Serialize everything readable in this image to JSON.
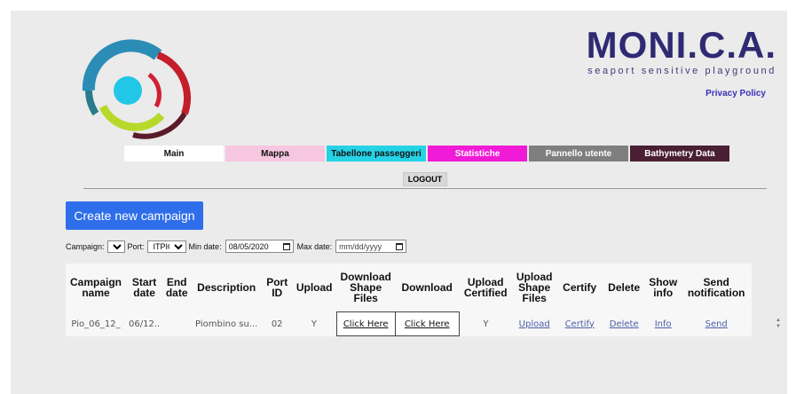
{
  "brand": {
    "title": "MONI.C.A.",
    "subtitle": "seaport sensitive playground",
    "privacy": "Privacy Policy"
  },
  "nav": [
    {
      "label": "Main",
      "bg": "#ffffff",
      "fg": "#111111"
    },
    {
      "label": "Mappa",
      "bg": "#f7c6e0",
      "fg": "#111111"
    },
    {
      "label": "Tabellone passeggeri",
      "bg": "#26d3e6",
      "fg": "#111111"
    },
    {
      "label": "Statistiche",
      "bg": "#f01bd6",
      "fg": "#ffffff"
    },
    {
      "label": "Pannello utente",
      "bg": "#7f7f7f",
      "fg": "#ffffff"
    },
    {
      "label": "Bathymetry Data",
      "bg": "#4a1f33",
      "fg": "#ffffff"
    }
  ],
  "logout": "LOGOUT",
  "create_button": "Create new campaign",
  "filters": {
    "campaign_label": "Campaign:",
    "port_label": "Port:",
    "port_value": "ITPIO",
    "min_label": "Min date:",
    "min_value": "08/05/2020",
    "max_label": "Max date:",
    "max_value": "mm/dd/yyyy"
  },
  "table": {
    "headers": [
      "Campaign name",
      "Start date",
      "End date",
      "Description",
      "Port ID",
      "Upload",
      "Download Shape Files",
      "Download",
      "Upload Certified",
      "Upload Shape Files",
      "Certify",
      "Delete",
      "Show info",
      "Send notification"
    ],
    "row": {
      "campaign": "Pio_06_12_",
      "start": "06/12..",
      "end": "",
      "description": "Piombino su...",
      "port_id": "02",
      "upload": "Y",
      "download_shape": "Click Here",
      "download": "Click Here",
      "upload_certified": "Y",
      "upload_shape": "Upload",
      "certify": "Certify",
      "delete": "Delete",
      "info": "Info",
      "send": "Send"
    }
  },
  "colors": {
    "accent": "#2f6eea",
    "brand": "#2f2a72"
  }
}
